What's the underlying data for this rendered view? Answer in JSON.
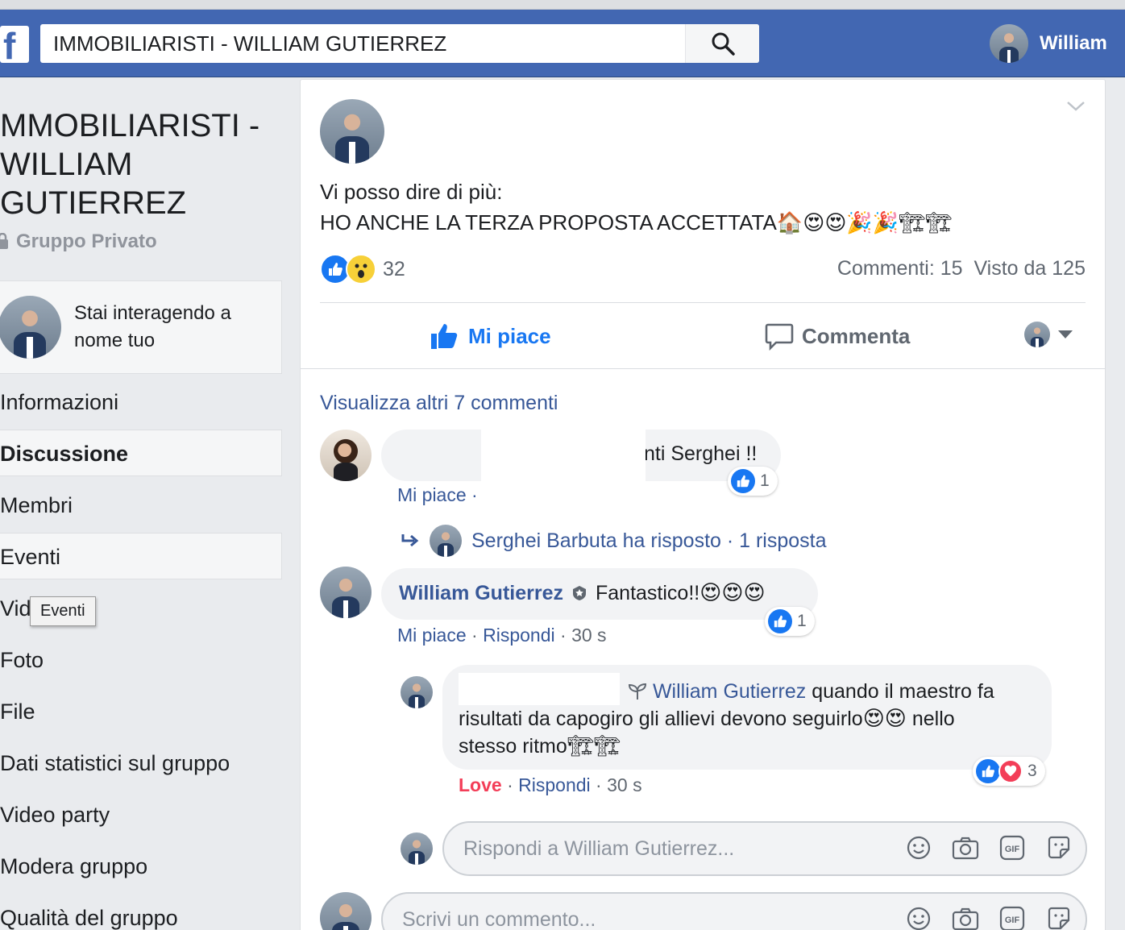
{
  "topbar": {
    "logo_letter": "f",
    "search_value": "IMMOBILIARISTI - WILLIAM GUTIERREZ",
    "user_name": "William"
  },
  "sidebar": {
    "group_title": "MMOBILIARISTI - WILLIAM GUTIERREZ",
    "privacy": "Gruppo Privato",
    "acting_as": "Stai interagendo a nome tuo",
    "nav": [
      "Informazioni",
      "Discussione",
      "Membri",
      "Eventi",
      "Vid",
      "Foto",
      "File",
      "Dati statistici sul gruppo",
      "Video party",
      "Modera gruppo",
      "Qualità del gruppo"
    ],
    "tooltip": "Eventi"
  },
  "post": {
    "line1": "Vi posso dire di più:",
    "line2": "HO ANCHE LA TERZA PROPOSTA ACCETTATA",
    "line2_emoji": "🏠😍😍🎉🎉🏗🏗",
    "reaction_count": "32",
    "comments_stat": "Commenti: 15",
    "views_stat": "Visto da 125",
    "like_label": "Mi piace",
    "comment_label": "Commenta",
    "more_comments": "Visualizza altri 7 commenti"
  },
  "comments": [
    {
      "text_visible": "nti Serghei !!",
      "meta_like": "Mi piace",
      "meta_sep": "·",
      "reactions": "1",
      "reply_summary": "Serghei Barbuta ha risposto · 1 risposta"
    },
    {
      "author": "William Gutierrez",
      "text": "Fantastico!!",
      "emoji": "😍😍😍",
      "meta_like": "Mi piace",
      "meta_reply": "Rispondi",
      "meta_time": "30 s",
      "reactions": "1"
    },
    {
      "mention": "William Gutierrez",
      "text_a": "quando il maestro fa",
      "text_b": "risultati da capogiro gli allievi devono seguirlo",
      "emoji_b": "😍😍",
      "text_c": "nello",
      "text_d": "stesso ritmo",
      "emoji_d": "🏗🏗",
      "meta_love": "Love",
      "meta_reply": "Rispondi",
      "meta_time": "30 s",
      "reactions": "3"
    }
  ],
  "composer_reply": {
    "placeholder": "Rispondi a William Gutierrez..."
  },
  "composer_main": {
    "placeholder": "Scrivi un commento..."
  },
  "colors": {
    "brand": "#4267b2",
    "link": "#385898",
    "like": "#1877f2",
    "love": "#f33e58"
  }
}
